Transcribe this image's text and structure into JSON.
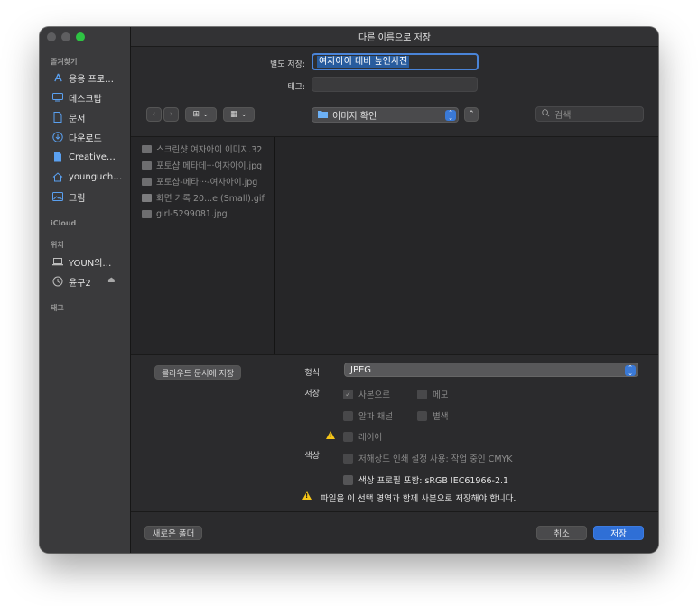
{
  "window": {
    "title": "다른 이름으로 저장",
    "traffic_colors": [
      "#5e5e60",
      "#5e5e60",
      "#2ec443"
    ]
  },
  "sidebar": {
    "favorites_header": "즐겨찾기",
    "favorites": [
      {
        "icon": "apps-icon",
        "label": "응용 프로…"
      },
      {
        "icon": "desktop-icon",
        "label": "데스크탑"
      },
      {
        "icon": "document-icon",
        "label": "문서"
      },
      {
        "icon": "download-icon",
        "label": "다운로드"
      },
      {
        "icon": "file-icon",
        "label": "Creative…"
      },
      {
        "icon": "home-icon",
        "label": "younguch…"
      },
      {
        "icon": "photo-icon",
        "label": "그림"
      }
    ],
    "icloud_header": "iCloud",
    "locations_header": "위치",
    "locations": [
      {
        "icon": "laptop-icon",
        "label": "YOUN의…"
      },
      {
        "icon": "clock-icon",
        "label": "윤구2",
        "eject": "⏏"
      }
    ],
    "tags_header": "태그"
  },
  "save_form": {
    "save_as_label": "별도 저장:",
    "save_as_value": "여자아이 대비 높인사진",
    "tags_label": "태그:",
    "tags_value": ""
  },
  "toolbar": {
    "back": "‹",
    "forward": "›",
    "view_columns": "⊞ ⌄",
    "view_grid": "▦ ⌄",
    "location": "이미지 확인",
    "expand": "⌃",
    "search_placeholder": "검색"
  },
  "files": [
    {
      "name": "스크린샷 여자아이 이미지.32",
      "type": "image"
    },
    {
      "name": "포토샵 메타데···여자아이.jpg",
      "type": "image"
    },
    {
      "name": "포토샵-메타···-여자아이.jpg",
      "type": "image"
    },
    {
      "name": "화면 기록 20...e (Small).gif",
      "type": "gif"
    },
    {
      "name": "girl-5299081.jpg",
      "type": "image"
    }
  ],
  "options": {
    "cloud_button": "클라우드 문서에 저장",
    "format_label": "형식:",
    "format_value": "JPEG",
    "save_label": "저장:",
    "as_copy": "사본으로",
    "notes": "메모",
    "alpha": "알파 채널",
    "spot": "별색",
    "layers": "레이어",
    "color_label": "색상:",
    "proof": "저해상도 인쇄 설정 사용: 작업 중인 CMYK",
    "icc": "색상 프로필 포함: sRGB IEC61966-2.1",
    "warning": "파일을 이 선택 영역과 함께 사본으로 저장해야 합니다."
  },
  "footer": {
    "new_folder": "새로운 폴더",
    "cancel": "취소",
    "save": "저장"
  }
}
